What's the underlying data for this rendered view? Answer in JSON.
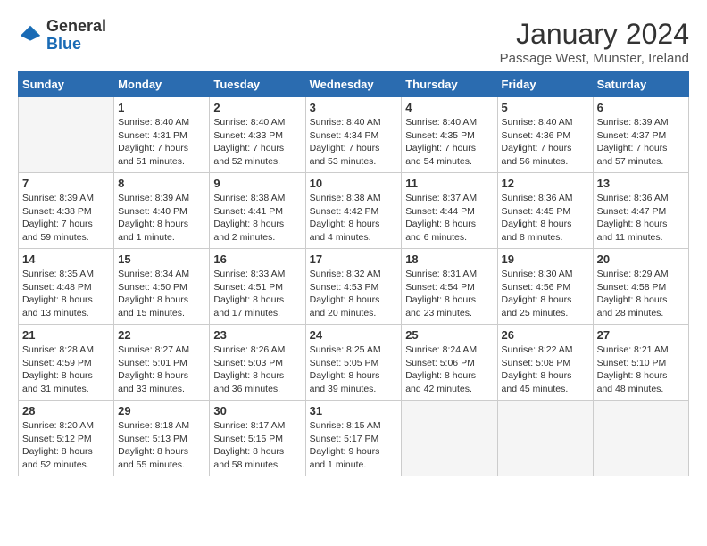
{
  "logo": {
    "general": "General",
    "blue": "Blue"
  },
  "title": "January 2024",
  "subtitle": "Passage West, Munster, Ireland",
  "days_of_week": [
    "Sunday",
    "Monday",
    "Tuesday",
    "Wednesday",
    "Thursday",
    "Friday",
    "Saturday"
  ],
  "weeks": [
    [
      {
        "day": "",
        "info": ""
      },
      {
        "day": "1",
        "info": "Sunrise: 8:40 AM\nSunset: 4:31 PM\nDaylight: 7 hours\nand 51 minutes."
      },
      {
        "day": "2",
        "info": "Sunrise: 8:40 AM\nSunset: 4:33 PM\nDaylight: 7 hours\nand 52 minutes."
      },
      {
        "day": "3",
        "info": "Sunrise: 8:40 AM\nSunset: 4:34 PM\nDaylight: 7 hours\nand 53 minutes."
      },
      {
        "day": "4",
        "info": "Sunrise: 8:40 AM\nSunset: 4:35 PM\nDaylight: 7 hours\nand 54 minutes."
      },
      {
        "day": "5",
        "info": "Sunrise: 8:40 AM\nSunset: 4:36 PM\nDaylight: 7 hours\nand 56 minutes."
      },
      {
        "day": "6",
        "info": "Sunrise: 8:39 AM\nSunset: 4:37 PM\nDaylight: 7 hours\nand 57 minutes."
      }
    ],
    [
      {
        "day": "7",
        "info": "Sunrise: 8:39 AM\nSunset: 4:38 PM\nDaylight: 7 hours\nand 59 minutes."
      },
      {
        "day": "8",
        "info": "Sunrise: 8:39 AM\nSunset: 4:40 PM\nDaylight: 8 hours\nand 1 minute."
      },
      {
        "day": "9",
        "info": "Sunrise: 8:38 AM\nSunset: 4:41 PM\nDaylight: 8 hours\nand 2 minutes."
      },
      {
        "day": "10",
        "info": "Sunrise: 8:38 AM\nSunset: 4:42 PM\nDaylight: 8 hours\nand 4 minutes."
      },
      {
        "day": "11",
        "info": "Sunrise: 8:37 AM\nSunset: 4:44 PM\nDaylight: 8 hours\nand 6 minutes."
      },
      {
        "day": "12",
        "info": "Sunrise: 8:36 AM\nSunset: 4:45 PM\nDaylight: 8 hours\nand 8 minutes."
      },
      {
        "day": "13",
        "info": "Sunrise: 8:36 AM\nSunset: 4:47 PM\nDaylight: 8 hours\nand 11 minutes."
      }
    ],
    [
      {
        "day": "14",
        "info": "Sunrise: 8:35 AM\nSunset: 4:48 PM\nDaylight: 8 hours\nand 13 minutes."
      },
      {
        "day": "15",
        "info": "Sunrise: 8:34 AM\nSunset: 4:50 PM\nDaylight: 8 hours\nand 15 minutes."
      },
      {
        "day": "16",
        "info": "Sunrise: 8:33 AM\nSunset: 4:51 PM\nDaylight: 8 hours\nand 17 minutes."
      },
      {
        "day": "17",
        "info": "Sunrise: 8:32 AM\nSunset: 4:53 PM\nDaylight: 8 hours\nand 20 minutes."
      },
      {
        "day": "18",
        "info": "Sunrise: 8:31 AM\nSunset: 4:54 PM\nDaylight: 8 hours\nand 23 minutes."
      },
      {
        "day": "19",
        "info": "Sunrise: 8:30 AM\nSunset: 4:56 PM\nDaylight: 8 hours\nand 25 minutes."
      },
      {
        "day": "20",
        "info": "Sunrise: 8:29 AM\nSunset: 4:58 PM\nDaylight: 8 hours\nand 28 minutes."
      }
    ],
    [
      {
        "day": "21",
        "info": "Sunrise: 8:28 AM\nSunset: 4:59 PM\nDaylight: 8 hours\nand 31 minutes."
      },
      {
        "day": "22",
        "info": "Sunrise: 8:27 AM\nSunset: 5:01 PM\nDaylight: 8 hours\nand 33 minutes."
      },
      {
        "day": "23",
        "info": "Sunrise: 8:26 AM\nSunset: 5:03 PM\nDaylight: 8 hours\nand 36 minutes."
      },
      {
        "day": "24",
        "info": "Sunrise: 8:25 AM\nSunset: 5:05 PM\nDaylight: 8 hours\nand 39 minutes."
      },
      {
        "day": "25",
        "info": "Sunrise: 8:24 AM\nSunset: 5:06 PM\nDaylight: 8 hours\nand 42 minutes."
      },
      {
        "day": "26",
        "info": "Sunrise: 8:22 AM\nSunset: 5:08 PM\nDaylight: 8 hours\nand 45 minutes."
      },
      {
        "day": "27",
        "info": "Sunrise: 8:21 AM\nSunset: 5:10 PM\nDaylight: 8 hours\nand 48 minutes."
      }
    ],
    [
      {
        "day": "28",
        "info": "Sunrise: 8:20 AM\nSunset: 5:12 PM\nDaylight: 8 hours\nand 52 minutes."
      },
      {
        "day": "29",
        "info": "Sunrise: 8:18 AM\nSunset: 5:13 PM\nDaylight: 8 hours\nand 55 minutes."
      },
      {
        "day": "30",
        "info": "Sunrise: 8:17 AM\nSunset: 5:15 PM\nDaylight: 8 hours\nand 58 minutes."
      },
      {
        "day": "31",
        "info": "Sunrise: 8:15 AM\nSunset: 5:17 PM\nDaylight: 9 hours\nand 1 minute."
      },
      {
        "day": "",
        "info": ""
      },
      {
        "day": "",
        "info": ""
      },
      {
        "day": "",
        "info": ""
      }
    ]
  ]
}
